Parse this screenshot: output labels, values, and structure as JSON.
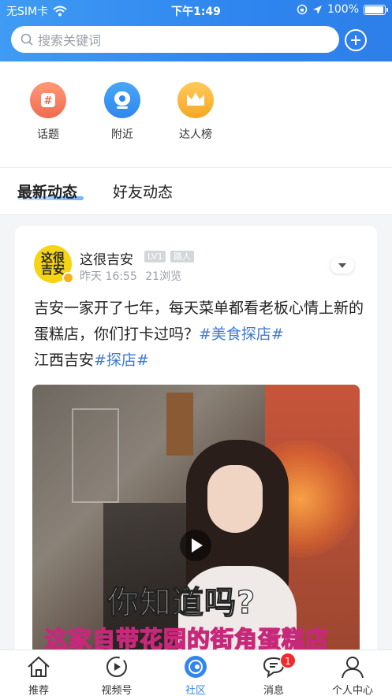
{
  "status_bar": {
    "carrier": "无SIM卡",
    "time": "下午1:49",
    "battery": "100%"
  },
  "search": {
    "placeholder": "搜索关键词"
  },
  "shortcuts": [
    {
      "label": "话题",
      "icon": "hashtag-icon"
    },
    {
      "label": "附近",
      "icon": "location-icon"
    },
    {
      "label": "达人榜",
      "icon": "crown-icon"
    }
  ],
  "tabs": {
    "latest": "最新动态",
    "friends": "好友动态"
  },
  "post": {
    "author": "这很吉安",
    "level_badge": "LV1",
    "role_badge": "路人",
    "time": "昨天 16:55",
    "views": "21浏览",
    "avatar_text": "这很吉安",
    "text_plain_1": "吉安一家开了七年，每天菜单都看老板心情上新的蛋糕店，你们打卡过吗？",
    "tag_1": "#美食探店#",
    "text_plain_2": "江西吉安",
    "tag_2": "#探店#",
    "subtitle_1": "你知道吗?",
    "subtitle_2": "这家自带花园的街角蛋糕店"
  },
  "tabbar": [
    {
      "label": "推荐",
      "icon": "home-icon"
    },
    {
      "label": "视频号",
      "icon": "video-icon"
    },
    {
      "label": "社区",
      "icon": "community-icon"
    },
    {
      "label": "消息",
      "icon": "message-icon",
      "badge": "1"
    },
    {
      "label": "个人中心",
      "icon": "user-icon"
    }
  ],
  "colors": {
    "brand_blue": "#2f86ef",
    "tag_blue": "#3c79d6",
    "badge_red": "#f02b2b"
  }
}
